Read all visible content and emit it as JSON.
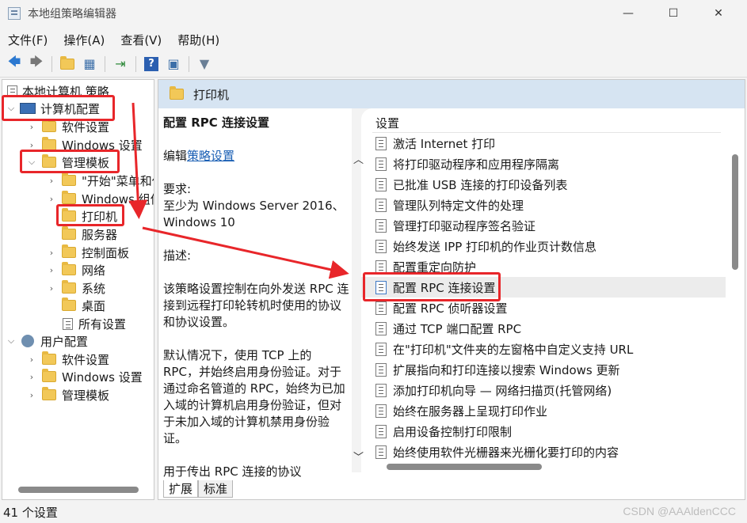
{
  "window": {
    "title": "本地组策略编辑器",
    "minimize": "—",
    "maximize": "☐",
    "close": "✕"
  },
  "menu": [
    "文件(F)",
    "操作(A)",
    "查看(V)",
    "帮助(H)"
  ],
  "tree": {
    "root": "本地计算机 策略",
    "computer": "计算机配置",
    "software": "软件设置",
    "windows": "Windows 设置",
    "admin": "管理模板",
    "start": "\"开始\"菜单和任务栏",
    "windows_comp": "Windows 组件",
    "printers": "打印机",
    "server": "服务器",
    "control": "控制面板",
    "network": "网络",
    "system": "系统",
    "desktop": "桌面",
    "all": "所有设置",
    "user": "用户配置",
    "user_software": "软件设置",
    "user_windows": "Windows 设置",
    "user_admin": "管理模板"
  },
  "header": {
    "title": "打印机"
  },
  "description": {
    "title": "配置 RPC 连接设置",
    "edit_prefix": "编辑",
    "edit_link": "策略设置",
    "requirement_label": "要求:",
    "requirement_text": "至少为 Windows Server 2016、Windows 10",
    "desc_label": "描述:",
    "desc_p1": "该策略设置控制在向外发送 RPC 连接到远程打印轮转机时使用的协议和协议设置。",
    "desc_p2": "默认情况下，使用 TCP 上的 RPC，并始终启用身份验证。对于通过命名管道的 RPC，始终为已加入域的计算机启用身份验证，但对于未加入域的计算机禁用身份验证。",
    "desc_p3": "用于传出 RPC 连接的协议"
  },
  "settings": {
    "column": "设置",
    "items": [
      "激活 Internet 打印",
      "将打印驱动程序和应用程序隔离",
      "已批准 USB 连接的打印设备列表",
      "管理队列特定文件的处理",
      "管理打印驱动程序签名验证",
      "始终发送 IPP 打印机的作业页计数信息",
      "配置重定向防护",
      "配置 RPC 连接设置",
      "配置 RPC 侦听器设置",
      "通过 TCP 端口配置 RPC",
      "在\"打印机\"文件夹的左窗格中自定义支持 URL",
      "扩展指向和打印连接以搜索 Windows 更新",
      "添加打印机向导 — 网络扫描页(托管网络)",
      "始终在服务器上呈现打印作业",
      "启用设备控制打印限制",
      "始终使用软件光栅器来光栅化要打印的内容"
    ]
  },
  "tabs": [
    "扩展",
    "标准"
  ],
  "status": "41 个设置",
  "watermark": "CSDN @AAAldenCCC",
  "annotation_color": "#e8262a"
}
